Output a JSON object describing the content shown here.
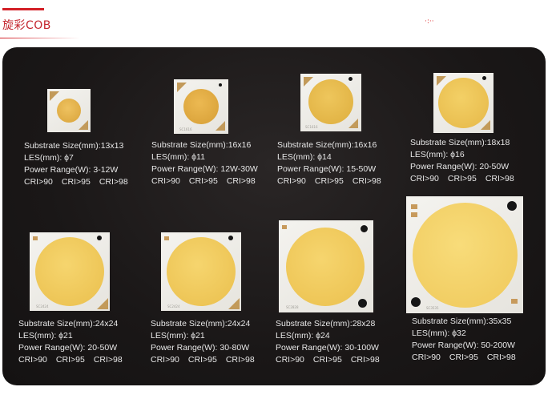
{
  "header": {
    "title": "旋彩COB",
    "corner_mark": "·:··"
  },
  "products": [
    {
      "substrate": "Substrate Size(mm):13x13",
      "les": "LES(mm): ϕ7",
      "power": "Power Range(W): 3-12W",
      "cri": [
        "CRI>90",
        "CRI>95",
        "CRI>98"
      ]
    },
    {
      "substrate": "Substrate Size(mm):16x16",
      "les": "LES(mm): ϕ11",
      "power": "Power Range(W): 12W-30W",
      "cri": [
        "CRI>90",
        "CRI>95",
        "CRI>98"
      ]
    },
    {
      "substrate": "Substrate Size(mm):16x16",
      "les": "LES(mm): ϕ14",
      "power": "Power Range(W): 15-50W",
      "cri": [
        "CRI>90",
        "CRI>95",
        "CRI>98"
      ]
    },
    {
      "substrate": "Substrate Size(mm):18x18",
      "les": "LES(mm): ϕ16",
      "power": "Power Range(W): 20-50W",
      "cri": [
        "CRI>90",
        "CRI>95",
        "CRI>98"
      ]
    },
    {
      "substrate": "Substrate Size(mm):24x24",
      "les": "LES(mm): ϕ21",
      "power": "Power Range(W): 20-50W",
      "cri": [
        "CRI>90",
        "CRI>95",
        "CRI>98"
      ]
    },
    {
      "substrate": "Substrate Size(mm):24x24",
      "les": "LES(mm): ϕ21",
      "power": "Power Range(W): 30-80W",
      "cri": [
        "CRI>90",
        "CRI>95",
        "CRI>98"
      ]
    },
    {
      "substrate": "Substrate Size(mm):28x28",
      "les": "LES(mm): ϕ24",
      "power": "Power Range(W): 30-100W",
      "cri": [
        "CRI>90",
        "CRI>95",
        "CRI>98"
      ]
    },
    {
      "substrate": "Substrate Size(mm):35x35",
      "les": "LES(mm): ϕ32",
      "power": "Power Range(W): 50-200W",
      "cri": [
        "CRI>90",
        "CRI>95",
        "CRI>98"
      ]
    }
  ],
  "chip_marks": {
    "m2": "SC1616",
    "m3": "SC1616",
    "m5": "SC2424",
    "m6": "SC2424",
    "m7": "SC2828",
    "m8": "SC3535"
  },
  "colors": {
    "accent": "#d31f26",
    "les_warm": "#e4b244",
    "les_light": "#f1cc5e",
    "panel": "#1a1717"
  }
}
